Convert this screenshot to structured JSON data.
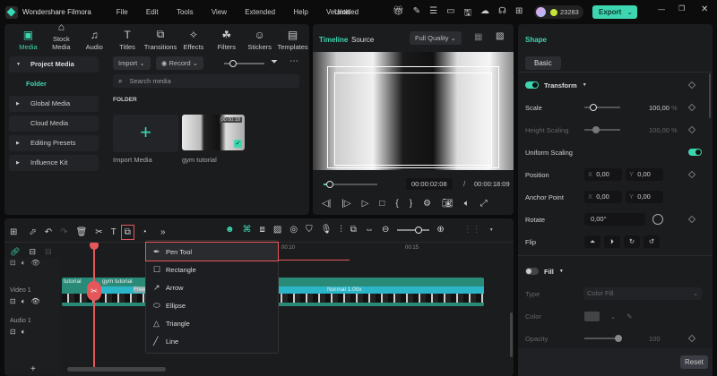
{
  "app": {
    "name": "Wondershare Filmora",
    "project": "Untitled",
    "credits": "23283",
    "export": "Export"
  },
  "menu": [
    "File",
    "Edit",
    "Tools",
    "View",
    "Extended",
    "Help",
    "Version"
  ],
  "media_tabs": [
    {
      "label": "Media",
      "icon": "media-icon"
    },
    {
      "label": "Stock Media",
      "icon": "stock-icon"
    },
    {
      "label": "Audio",
      "icon": "audio-icon"
    },
    {
      "label": "Titles",
      "icon": "titles-icon"
    },
    {
      "label": "Transitions",
      "icon": "transitions-icon"
    },
    {
      "label": "Effects",
      "icon": "effects-icon"
    },
    {
      "label": "Filters",
      "icon": "filters-icon"
    },
    {
      "label": "Stickers",
      "icon": "stickers-icon"
    },
    {
      "label": "Templates",
      "icon": "templates-icon"
    }
  ],
  "sidebar": {
    "project_media": "Project Media",
    "folder": "Folder",
    "global_media": "Global Media",
    "cloud_media": "Cloud Media",
    "editing_presets": "Editing Presets",
    "influence_kit": "Influence Kit"
  },
  "media": {
    "import": "Import",
    "record": "Record",
    "search_placeholder": "Search media",
    "folder_heading": "FOLDER",
    "import_media": "Import Media",
    "clip_name": "gym tutorial",
    "clip_duration": "00:00:18"
  },
  "preview": {
    "tab_timeline": "Timeline",
    "tab_source": "Source",
    "quality": "Full Quality",
    "current_time": "00:00:02:08",
    "separator": "/",
    "total_time": "00:00:18:09",
    "progress": 0.12
  },
  "props": {
    "title": "Shape",
    "tab_basic": "Basic",
    "transform": "Transform",
    "scale": "Scale",
    "scale_value": "100,00",
    "pct": "%",
    "height_scaling": "Height Scaling",
    "height_value": "100,00",
    "uniform_scaling": "Uniform Scaling",
    "position": "Position",
    "anchor": "Anchor Point",
    "x": "X",
    "y": "Y",
    "zero": "0,00",
    "rotate": "Rotate",
    "rotate_value": "0,00°",
    "flip": "Flip",
    "fill": "Fill",
    "type": "Type",
    "type_value": "Color Fill",
    "color": "Color",
    "opacity": "Opacity",
    "opacity_value": "100",
    "reset": "Reset"
  },
  "timeline": {
    "ruler_10": "00:10",
    "ruler_15": "00:15",
    "video_track": "Video 1",
    "audio_track": "Audio 1",
    "clip_label": "gym tutorial",
    "clip_label2": "tutorial",
    "freeze": "Free",
    "speed": "Normal 1.00x",
    "add": "+"
  },
  "shape_menu": [
    {
      "label": "Pen Tool",
      "icon": "pen-tool-icon",
      "glyph": "✒"
    },
    {
      "label": "Rectangle",
      "icon": "rectangle-icon",
      "glyph": "☐"
    },
    {
      "label": "Arrow",
      "icon": "arrow-icon",
      "glyph": "↗"
    },
    {
      "label": "Ellipse",
      "icon": "ellipse-icon",
      "glyph": "⬭"
    },
    {
      "label": "Triangle",
      "icon": "triangle-icon",
      "glyph": "△"
    },
    {
      "label": "Line",
      "icon": "line-icon",
      "glyph": "╱"
    }
  ],
  "colors": {
    "accent": "#3dd6b0",
    "playhead": "#e5575a",
    "clip": "#2a8a78",
    "speed_bar": "#2ab5c9"
  }
}
